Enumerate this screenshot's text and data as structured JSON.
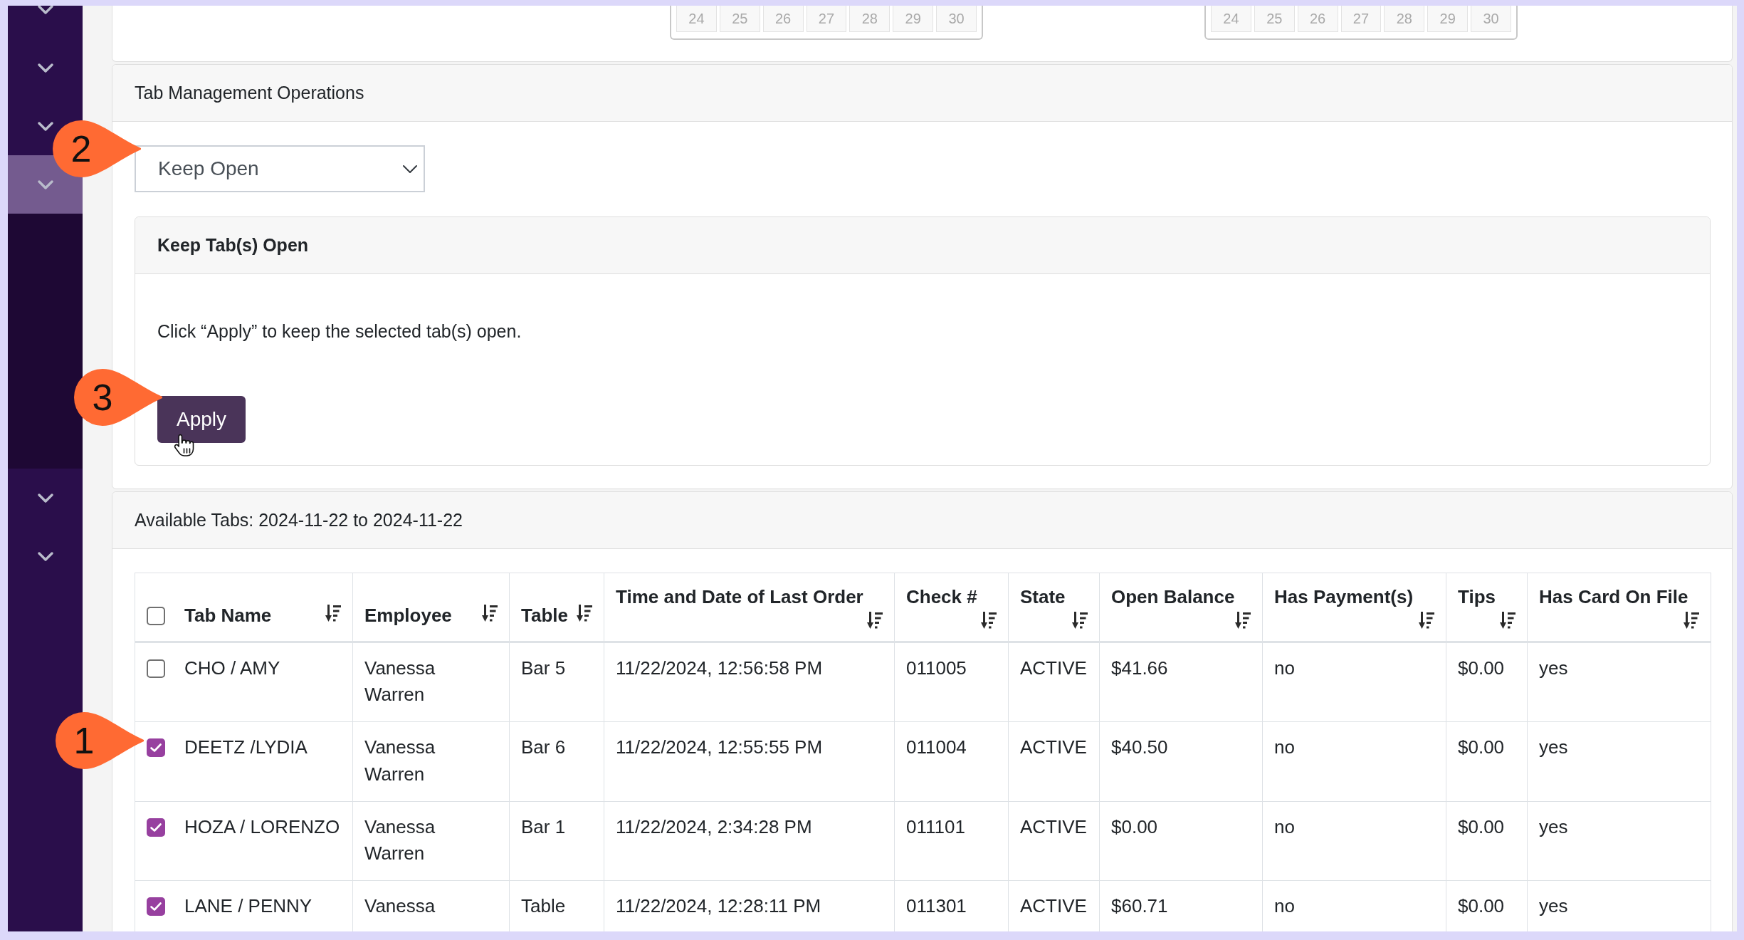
{
  "sidebar": {
    "items": [
      {
        "expanded": false
      },
      {
        "expanded": false
      },
      {
        "expanded": false
      },
      {
        "expanded": true
      },
      {
        "expanded": false
      },
      {
        "expanded": false
      }
    ]
  },
  "date_filters": [
    {
      "days": [
        "24",
        "25",
        "26",
        "27",
        "28",
        "29",
        "30"
      ]
    },
    {
      "days": [
        "24",
        "25",
        "26",
        "27",
        "28",
        "29",
        "30"
      ]
    }
  ],
  "operations_panel": {
    "title": "Tab Management Operations",
    "operation_select": {
      "value": "Keep Open",
      "callout": "2"
    },
    "action_card": {
      "title": "Keep Tab(s) Open",
      "description": "Click “Apply” to keep the selected tab(s) open.",
      "button": {
        "label": "Apply",
        "callout": "3"
      }
    }
  },
  "tabs_panel": {
    "title": "Available Tabs: 2024-11-22 to 2024-11-22",
    "select_all": {
      "checked": false
    },
    "columns": [
      "Tab Name",
      "Employee",
      "Table",
      "Time and Date of Last Order",
      "Check #",
      "State",
      "Open Balance",
      "Has Payment(s)",
      "Tips",
      "Has Card On File"
    ],
    "rows": [
      {
        "checked": false,
        "cells": [
          "CHO / AMY",
          "Vanessa Warren",
          "Bar 5",
          "11/22/2024, 12:56:58 PM",
          "011005",
          "ACTIVE",
          "$41.66",
          "no",
          "$0.00",
          "yes"
        ]
      },
      {
        "checked": true,
        "callout": "1",
        "cells": [
          "DEETZ /LYDIA",
          "Vanessa Warren",
          "Bar 6",
          "11/22/2024, 12:55:55 PM",
          "011004",
          "ACTIVE",
          "$40.50",
          "no",
          "$0.00",
          "yes"
        ]
      },
      {
        "checked": true,
        "cells": [
          "HOZA / LORENZO",
          "Vanessa Warren",
          "Bar 1",
          "11/22/2024, 2:34:28 PM",
          "011101",
          "ACTIVE",
          "$0.00",
          "no",
          "$0.00",
          "yes"
        ]
      },
      {
        "checked": true,
        "cells": [
          "LANE / PENNY",
          "Vanessa",
          "Table",
          "11/22/2024, 12:28:11 PM",
          "011301",
          "ACTIVE",
          "$60.71",
          "no",
          "$0.00",
          "yes"
        ]
      }
    ]
  }
}
